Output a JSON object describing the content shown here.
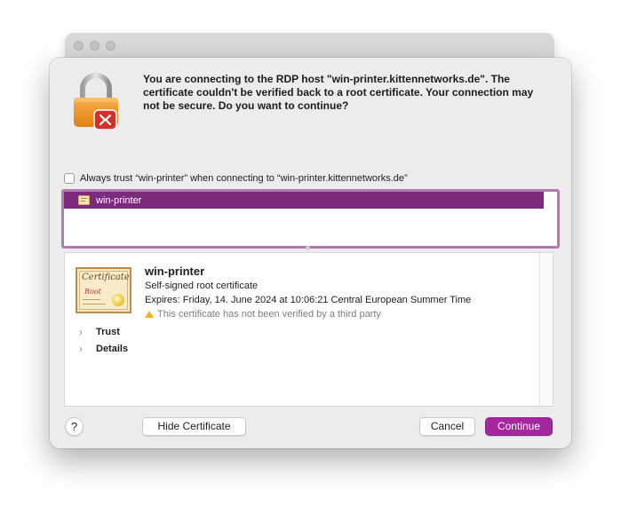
{
  "dialog": {
    "message": "You are connecting to the RDP host \"win-printer.kittennetworks.de\". The certificate couldn't be verified back to a root certificate. Your connection may not be secure. Do you want to continue?",
    "always_trust_label": "Always trust “win-printer” when connecting to “win-printer.kittennetworks.de”",
    "always_trust_checked": false,
    "lock_icon": "lock-with-rdp-badge-icon",
    "accent_color": "#a5279e"
  },
  "cert_list": {
    "items": [
      {
        "label": "win-printer",
        "icon": "certificate-icon",
        "selected": true
      }
    ],
    "selection_color": "#7b2a7c"
  },
  "certificate": {
    "graphic_title": "Certificate",
    "graphic_subtitle": "Root",
    "name": "win-printer",
    "type": "Self-signed root certificate",
    "expires": "Expires: Friday, 14. June 2024 at 10:06:21 Central European Summer Time",
    "warning": "This certificate has not been verified by a third party",
    "sections": [
      "Trust",
      "Details"
    ]
  },
  "buttons": {
    "help": "?",
    "hide_certificate": "Hide Certificate",
    "cancel": "Cancel",
    "continue": "Continue"
  }
}
